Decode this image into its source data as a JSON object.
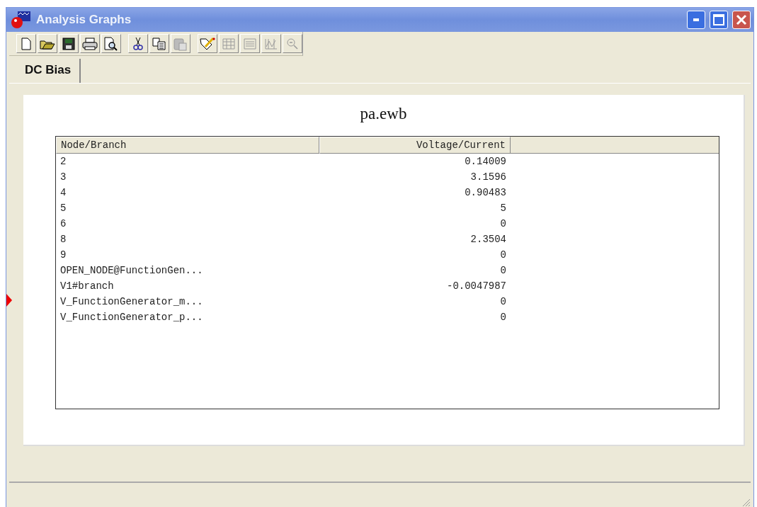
{
  "window": {
    "title": "Analysis Graphs"
  },
  "toolbar_groups": [
    [
      {
        "kind": "new",
        "disabled": false
      },
      {
        "kind": "open",
        "disabled": false
      },
      {
        "kind": "save",
        "disabled": false
      },
      {
        "kind": "print",
        "disabled": false
      },
      {
        "kind": "preview",
        "disabled": false
      }
    ],
    [
      {
        "kind": "cut",
        "disabled": false
      },
      {
        "kind": "copy",
        "disabled": false
      },
      {
        "kind": "paste",
        "disabled": true
      }
    ],
    [
      {
        "kind": "properties",
        "disabled": false
      },
      {
        "kind": "grid",
        "disabled": true
      },
      {
        "kind": "legend",
        "disabled": true
      },
      {
        "kind": "cursors",
        "disabled": true
      },
      {
        "kind": "zoom",
        "disabled": true
      }
    ]
  ],
  "tabs": [
    {
      "label": "DC Bias",
      "selected": true
    }
  ],
  "document": {
    "title": "pa.ewb"
  },
  "table": {
    "columns": [
      "Node/Branch",
      "Voltage/Current"
    ],
    "rows": [
      [
        "2",
        "0.14009"
      ],
      [
        "3",
        "3.1596"
      ],
      [
        "4",
        "0.90483"
      ],
      [
        "5",
        "5"
      ],
      [
        "6",
        "0"
      ],
      [
        "8",
        "2.3504"
      ],
      [
        "9",
        "0"
      ],
      [
        "OPEN_NODE@FunctionGen...",
        "0"
      ],
      [
        "V1#branch",
        "-0.0047987"
      ],
      [
        "V_FunctionGenerator_m...",
        "0"
      ],
      [
        "V_FunctionGenerator_p...",
        "0"
      ]
    ]
  }
}
